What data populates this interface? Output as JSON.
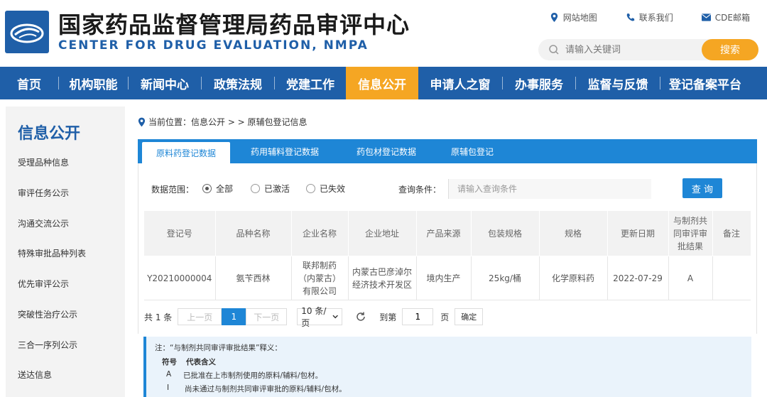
{
  "header": {
    "title_cn": "国家药品监督管理局药品审评中心",
    "title_en": "CENTER FOR DRUG EVALUATION, NMPA",
    "links": [
      "网站地图",
      "联系我们",
      "CDE邮箱"
    ],
    "search_placeholder": "请输入关键词",
    "search_button": "搜索"
  },
  "nav": {
    "items": [
      "首页",
      "机构职能",
      "新闻中心",
      "政策法规",
      "党建工作",
      "信息公开",
      "申请人之窗",
      "办事服务",
      "监督与反馈",
      "登记备案平台"
    ],
    "active_index": 5
  },
  "sidebar": {
    "title": "信息公开",
    "items": [
      "受理品种信息",
      "审评任务公示",
      "沟通交流公示",
      "特殊审批品种列表",
      "优先审评公示",
      "突破性治疗公示",
      "三合一序列公示",
      "送达信息"
    ]
  },
  "breadcrumb": {
    "prefix": "当前位置：信息公开 > > 原辅包登记信息"
  },
  "tabs": [
    "原料药登记数据",
    "药用辅料登记数据",
    "药包材登记数据",
    "原辅包登记"
  ],
  "filter": {
    "scope_label": "数据范围：",
    "options": [
      "全部",
      "已激活",
      "已失效"
    ],
    "selected": "全部",
    "condition_label": "查询条件：",
    "condition_placeholder": "请输入查询条件",
    "query_button": "查 询"
  },
  "table": {
    "headers": [
      "登记号",
      "品种名称",
      "企业名称",
      "企业地址",
      "产品来源",
      "包装规格",
      "规格",
      "更新日期",
      "与制剂共同审评审批结果",
      "备注"
    ],
    "rows": [
      [
        "Y20210000004",
        "氨苄西林",
        "联邦制药（内蒙古）有限公司",
        "内蒙古巴彦淖尔经济技术开发区",
        "境内生产",
        "25kg/桶",
        "化学原料药",
        "2022-07-29",
        "A",
        ""
      ]
    ]
  },
  "pager": {
    "total": "共 1 条",
    "prev": "上一页",
    "current": "1",
    "next": "下一页",
    "page_size": "10 条/页",
    "goto_label": "到第",
    "goto_value": "1",
    "page_unit": "页",
    "confirm": "确定"
  },
  "note": {
    "title": "注：“与制剂共同审评审批结果”释义：",
    "header_symbol": "符号",
    "header_meaning": "代表含义",
    "rows": [
      {
        "symbol": "A",
        "meaning": "已批准在上市制剂使用的原料/辅料/包材。"
      },
      {
        "symbol": "I",
        "meaning": "尚未通过与制剂共同审评审批的原料/辅料/包材。"
      }
    ]
  },
  "colors": {
    "primary": "#1f5fa8",
    "accent": "#f5a623",
    "tab_blue": "#1e86d6"
  }
}
